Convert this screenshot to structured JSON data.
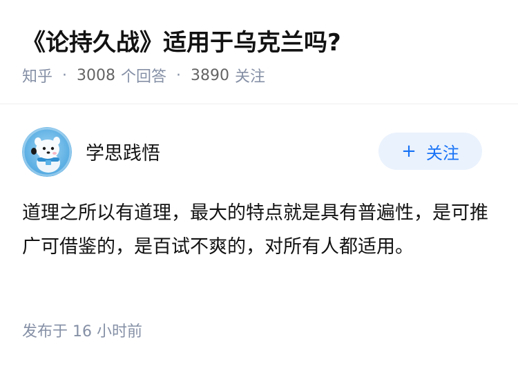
{
  "question": {
    "title": "《论持久战》适用于乌克兰吗?"
  },
  "meta": {
    "source": "知乎",
    "separator": "·",
    "answer_count": "3008",
    "answer_label": "个回答",
    "follower_count": "3890",
    "follower_label": "关注"
  },
  "author": {
    "name": "学思践悟",
    "avatar_icon": "mascot-avatar-icon",
    "follow_button": {
      "plus": "+",
      "label": "关注"
    }
  },
  "answer": {
    "text": "道理之所以有道理，最大的特点就是具有普遍性，是可推广可借鉴的，是百试不爽的，对所有人都适用。",
    "publish_time": "发布于 16 小时前"
  },
  "colors": {
    "accent": "#1772f6",
    "follow_bg": "#eaf2fd",
    "meta_gray": "#8590a6",
    "text": "#121212"
  }
}
